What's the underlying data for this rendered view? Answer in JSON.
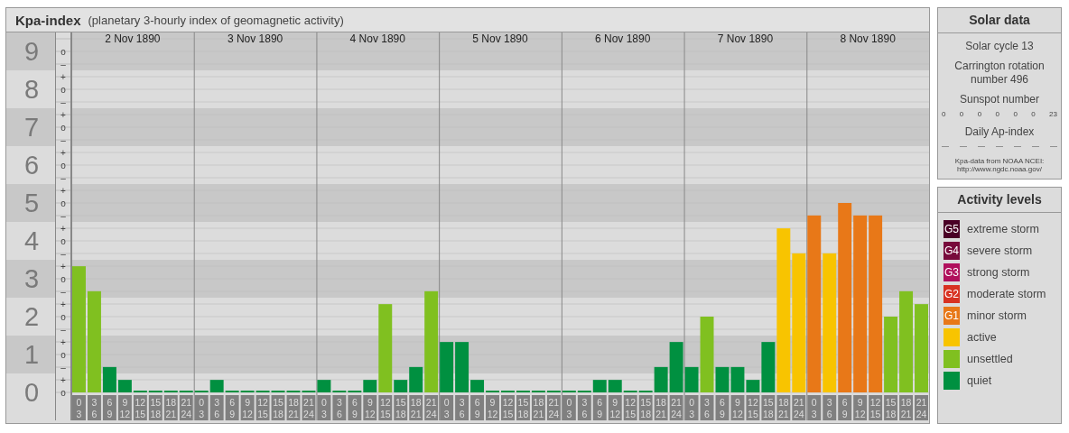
{
  "header": {
    "title": "Kpa-index",
    "subtitle": "(planetary 3-hourly index of geomagnetic activity)"
  },
  "chart": {
    "days": [
      "2 Nov 1890",
      "3 Nov 1890",
      "4 Nov 1890",
      "5 Nov 1890",
      "6 Nov 1890",
      "7 Nov 1890",
      "8 Nov 1890"
    ],
    "sublevel_marks": [
      "o",
      "–",
      "+",
      "o",
      "–",
      "+",
      "o",
      "–",
      "+",
      "o",
      "–",
      "+",
      "o",
      "–",
      "+",
      "o",
      "–",
      "+",
      "o",
      "–",
      "+",
      "o",
      "–",
      "+",
      "o",
      "–",
      "+",
      "o"
    ],
    "chart_data": {
      "type": "bar",
      "stacked": true,
      "grid": true,
      "bands": [
        {
          "axis": "y",
          "from": 0.5,
          "to": 1.5
        },
        {
          "axis": "y",
          "from": 2.5,
          "to": 3.5
        },
        {
          "axis": "y",
          "from": 4.5,
          "to": 5.5
        },
        {
          "axis": "y",
          "from": 6.5,
          "to": 7.5
        },
        {
          "axis": "y",
          "from": 8.5,
          "to": 9.5
        }
      ],
      "ylim": [
        0,
        9.5
      ],
      "yticks": [
        0,
        1,
        2,
        3,
        4,
        5,
        6,
        7,
        8,
        9
      ],
      "categories": [
        "0\n3",
        "3\n6",
        "6\n9",
        "9\n12",
        "12\n15",
        "15\n18",
        "18\n21",
        "21\n24",
        "0\n3",
        "3\n6",
        "6\n9",
        "9\n12",
        "12\n15",
        "15\n18",
        "18\n21",
        "21\n24",
        "0\n3",
        "3\n6",
        "6\n9",
        "9\n12",
        "12\n15",
        "15\n18",
        "18\n21",
        "21\n24",
        "0\n3",
        "3\n6",
        "6\n9",
        "9\n12",
        "12\n15",
        "15\n18",
        "18\n21",
        "21\n24",
        "0\n3",
        "3\n6",
        "6\n9",
        "9\n12",
        "12\n15",
        "15\n18",
        "18\n21",
        "21\n24",
        "0\n3",
        "3\n6",
        "6\n9",
        "9\n12",
        "12\n15",
        "15\n18",
        "18\n21",
        "21\n24",
        "0\n3",
        "3\n6",
        "6\n9",
        "9\n12",
        "12\n15",
        "15\n18",
        "18\n21",
        "21\n24"
      ],
      "series": [
        {
          "color": "#009040",
          "values": [
            null,
            null,
            0.67,
            0.33,
            0,
            0,
            0,
            0,
            0,
            0.33,
            0,
            0,
            0,
            0,
            0,
            0,
            0.33,
            0,
            0,
            0.33,
            null,
            0.33,
            0.67,
            null,
            1.33,
            1.33,
            0.33,
            0,
            0,
            0,
            0,
            0,
            0,
            0,
            0.33,
            0.33,
            0,
            0,
            0.67,
            1.33,
            0.67,
            null,
            0.67,
            0.67,
            0.33,
            1.33,
            null,
            null,
            null,
            null,
            null,
            null,
            null,
            null,
            null,
            null
          ]
        },
        {
          "color": "#80c020",
          "values": [
            3.33,
            2.67,
            null,
            null,
            null,
            null,
            null,
            null,
            null,
            null,
            null,
            null,
            null,
            null,
            null,
            null,
            null,
            null,
            null,
            null,
            2.33,
            null,
            null,
            2.67,
            null,
            null,
            null,
            null,
            null,
            null,
            null,
            null,
            null,
            null,
            null,
            null,
            null,
            null,
            null,
            null,
            null,
            2,
            null,
            null,
            null,
            null,
            null,
            null,
            null,
            null,
            null,
            null,
            null,
            2,
            2.67,
            2.33
          ]
        },
        {
          "color": "#f8c400",
          "values": [
            null,
            null,
            null,
            null,
            null,
            null,
            null,
            null,
            null,
            null,
            null,
            null,
            null,
            null,
            null,
            null,
            null,
            null,
            null,
            null,
            null,
            null,
            null,
            null,
            null,
            null,
            null,
            null,
            null,
            null,
            null,
            null,
            null,
            null,
            null,
            null,
            null,
            null,
            null,
            null,
            null,
            null,
            null,
            null,
            null,
            null,
            4.33,
            3.67,
            null,
            3.67,
            null,
            null,
            null,
            null,
            null,
            null
          ]
        },
        {
          "color": "#e87818",
          "values": [
            null,
            null,
            null,
            null,
            null,
            null,
            null,
            null,
            null,
            null,
            null,
            null,
            null,
            null,
            null,
            null,
            null,
            null,
            null,
            null,
            null,
            null,
            null,
            null,
            null,
            null,
            null,
            null,
            null,
            null,
            null,
            null,
            null,
            null,
            null,
            null,
            null,
            null,
            null,
            null,
            null,
            null,
            null,
            null,
            null,
            null,
            null,
            null,
            4.67,
            null,
            5,
            4.67,
            4.67,
            null,
            null,
            null
          ]
        }
      ]
    }
  },
  "solar_data": {
    "title": "Solar data",
    "solar_cycle": "Solar cycle 13",
    "carrington": "Carrington rotation number 496",
    "sunspot_title": "Sunspot number",
    "sunspot_values": [
      "0",
      "0",
      "0",
      "0",
      "0",
      "0",
      "23"
    ],
    "ap_title": "Daily Ap-index",
    "ap_values": [
      "—",
      "—",
      "—",
      "—",
      "—",
      "—",
      "—"
    ],
    "credit": [
      "Kpa-data from NOAA NCEI:",
      "http://www.ngdc.noaa.gov/"
    ]
  },
  "activity_levels": {
    "title": "Activity levels",
    "items": [
      {
        "badge": "G5",
        "label": "extreme storm",
        "color": "#4a0026"
      },
      {
        "badge": "G4",
        "label": "severe storm",
        "color": "#780a3c"
      },
      {
        "badge": "G3",
        "label": "strong storm",
        "color": "#b0105c"
      },
      {
        "badge": "G2",
        "label": "moderate storm",
        "color": "#d83222"
      },
      {
        "badge": "G1",
        "label": "minor storm",
        "color": "#e87818"
      },
      {
        "label": "active",
        "color": "#f8c400"
      },
      {
        "label": "unsettled",
        "color": "#80c020"
      },
      {
        "label": "quiet",
        "color": "#009040"
      }
    ]
  }
}
